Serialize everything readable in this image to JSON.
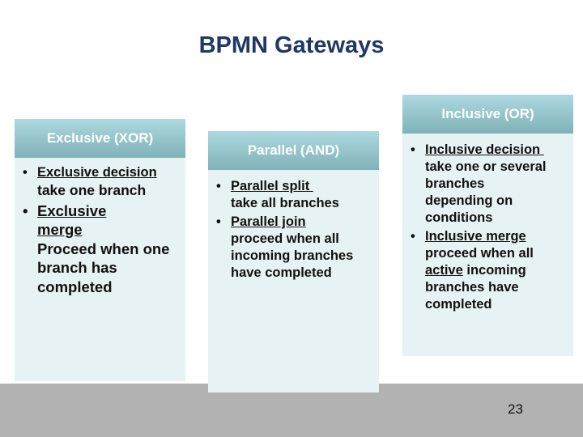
{
  "title": "BPMN Gateways",
  "page_number": "23",
  "cards": [
    {
      "id": "xor",
      "header": "Exclusive (XOR)",
      "items": [
        {
          "term": "Exclusive decision",
          "desc": "take one branch"
        },
        {
          "term": "Exclusive merge",
          "desc": "Proceed when one branch has completed"
        }
      ]
    },
    {
      "id": "and",
      "header": "Parallel (AND)",
      "items": [
        {
          "term": "Parallel split ",
          "desc": "take all branches"
        },
        {
          "term": "Parallel join",
          "desc": "proceed when all incoming branches have completed"
        }
      ]
    },
    {
      "id": "or",
      "header": "Inclusive (OR)",
      "items": [
        {
          "term": "Inclusive decision ",
          "desc": "take one or several branches depending on conditions"
        },
        {
          "term": "Inclusive merge",
          "desc_pre": "proceed when all ",
          "desc_u": "active",
          "desc_post": " incoming branches have completed"
        }
      ]
    }
  ],
  "colors": {
    "title": "#1f3864",
    "header_top": "#add9df",
    "header_bottom": "#7fb2b8",
    "card_bg": "#e6f2f3",
    "footer": "#b2b2b2"
  }
}
